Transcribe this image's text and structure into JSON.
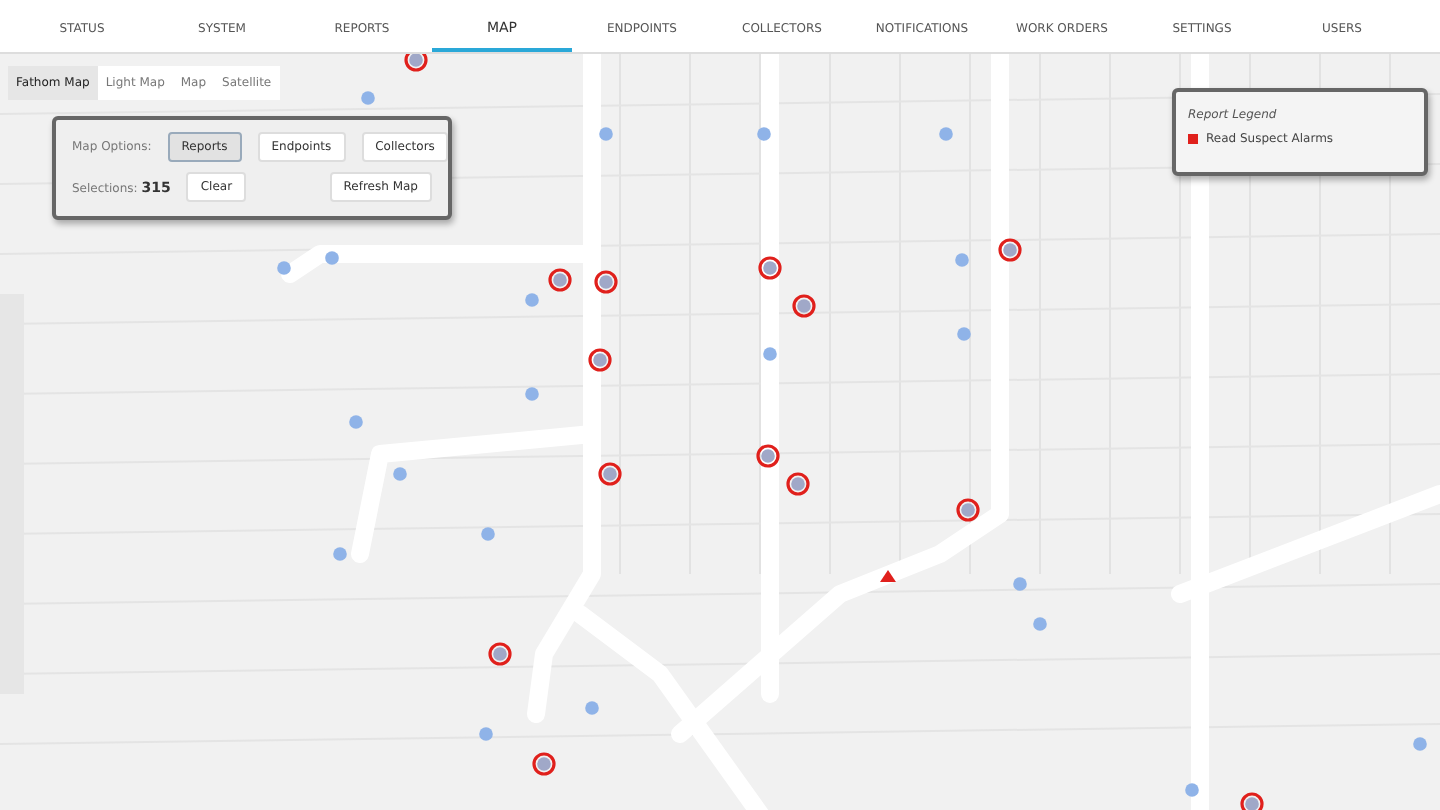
{
  "nav": {
    "tabs": [
      {
        "label": "STATUS",
        "selected": false
      },
      {
        "label": "SYSTEM",
        "selected": false
      },
      {
        "label": "REPORTS",
        "selected": false
      },
      {
        "label": "MAP",
        "selected": true
      },
      {
        "label": "ENDPOINTS",
        "selected": false
      },
      {
        "label": "COLLECTORS",
        "selected": false
      },
      {
        "label": "NOTIFICATIONS",
        "selected": false
      },
      {
        "label": "WORK ORDERS",
        "selected": false
      },
      {
        "label": "SETTINGS",
        "selected": false
      },
      {
        "label": "USERS",
        "selected": false
      }
    ]
  },
  "map_types": [
    {
      "label": "Fathom Map",
      "selected": true
    },
    {
      "label": "Light Map",
      "selected": false
    },
    {
      "label": "Map",
      "selected": false
    },
    {
      "label": "Satellite",
      "selected": false
    }
  ],
  "map_options": {
    "label": "Map Options:",
    "buttons": [
      {
        "label": "Reports",
        "selected": true
      },
      {
        "label": "Endpoints",
        "selected": false
      },
      {
        "label": "Collectors",
        "selected": false
      }
    ],
    "selections_label": "Selections:",
    "selections_count": "315",
    "clear": "Clear",
    "refresh": "Refresh Map"
  },
  "legend": {
    "title": "Report Legend",
    "items": [
      {
        "label": "Read Suspect Alarms",
        "color": "#e0201c"
      }
    ]
  }
}
